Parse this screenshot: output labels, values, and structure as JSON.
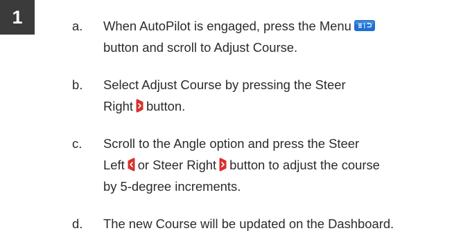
{
  "step_number": "1",
  "steps": [
    {
      "letter": "a.",
      "line1_before": "When AutoPilot is engaged, press the Menu",
      "line1_icon": "menu-button-icon",
      "line2": "button and scroll to Adjust Course."
    },
    {
      "letter": "b.",
      "line1": "Select Adjust Course by pressing the Steer",
      "line2_before": "Right",
      "line2_icon": "steer-right-button-icon",
      "line2_after": "button."
    },
    {
      "letter": "c.",
      "line1": "Scroll to the Angle option and press the Steer",
      "line2_a": "Left",
      "line2_icon1": "steer-left-button-icon",
      "line2_b": "or Steer Right",
      "line2_icon2": "steer-right-button-icon",
      "line2_c": "button to adjust the course",
      "line3": "by 5-degree increments."
    },
    {
      "letter": "d.",
      "line1": "The new Course will be updated on the Dashboard."
    }
  ],
  "colors": {
    "badge_background": "#3b3b3b",
    "text": "#2b2b2b",
    "menu_icon_blue": "#1f6fd1",
    "steer_icon_red": "#d9302c"
  }
}
